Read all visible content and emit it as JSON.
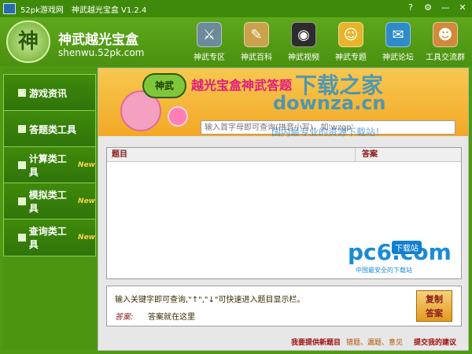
{
  "window": {
    "brand": "52pk游戏网",
    "title": "神武越光宝盒 V1.2.4",
    "controls": [
      "?",
      "⚙",
      "—",
      "✕"
    ]
  },
  "header": {
    "logo_glyph": "神",
    "title": "神武越光宝盒",
    "url": "shenwu.52pk.com",
    "nav": [
      {
        "label": "神武专区",
        "icon": "sword-icon"
      },
      {
        "label": "神武百科",
        "icon": "notebook-icon"
      },
      {
        "label": "神武视频",
        "icon": "camera-lens-icon"
      },
      {
        "label": "神武专题",
        "icon": "smiley-star-icon"
      },
      {
        "label": "神武论坛",
        "icon": "chat-bubbles-icon"
      },
      {
        "label": "工具交流群",
        "icon": "users-icon"
      }
    ]
  },
  "sidebar": {
    "items": [
      {
        "label": "游戏资讯",
        "new": ""
      },
      {
        "label": "答题类工具",
        "new": ""
      },
      {
        "label": "计算类工具",
        "new": "New"
      },
      {
        "label": "模拟类工具",
        "new": "New"
      },
      {
        "label": "查询类工具",
        "new": "New"
      }
    ]
  },
  "main": {
    "banner": {
      "emblem": "神武",
      "title": "越光宝盒神武答题"
    },
    "watermarks": {
      "line1": "下载之家",
      "line2": "downza.cn",
      "line3": "国内最专业的资源下载站！"
    },
    "search": {
      "placeholder": "输入首字母即可查询(拼音小写)，如'wzgp'"
    },
    "table": {
      "headers": [
        "题目",
        "答案"
      ]
    },
    "pc6": {
      "logo": "pc6.com",
      "badge": "下载站",
      "sub": "中国最安全的下载站"
    },
    "answer": {
      "tip": "输入关键字即可查询,\"↑\",\"↓\"可快速进入题目显示栏。",
      "label": "答案:",
      "value": "答案就在这里"
    },
    "copy_button": {
      "line1": "复制",
      "line2": "答案"
    },
    "footer": {
      "link1": "我要提供新题目",
      "link2": "错题、漏题、意见",
      "link3": "提交我的建议"
    }
  }
}
